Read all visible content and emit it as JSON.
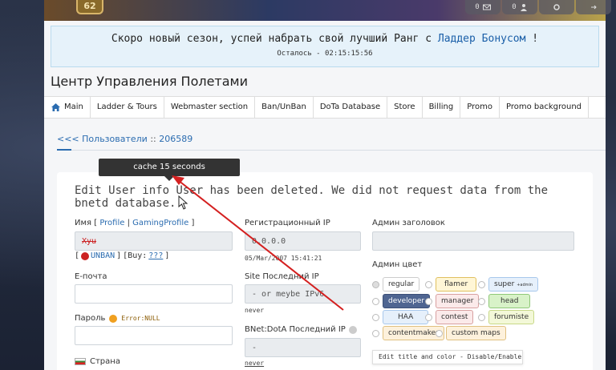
{
  "top": {
    "level": "62",
    "icons": [
      {
        "name": "mail-icon",
        "count": "0"
      },
      {
        "name": "friends-icon",
        "count": "0"
      },
      {
        "name": "settings-icon",
        "count": ""
      },
      {
        "name": "logout-icon",
        "count": ""
      }
    ]
  },
  "notice": {
    "text_before": "Скоро новый сезон, успей набрать свой лучший Ранг с",
    "link": "Ладдер Бонусом",
    "text_after": "!",
    "remaining_label": "Осталось -",
    "remaining_time": "02:15:15:56"
  },
  "title": "Центр Управления Полетами",
  "nav": [
    "Main",
    "Ladder & Tours",
    "Webmaster section",
    "Ban/UnBan",
    "DoTa Database",
    "Store",
    "Billing",
    "Promo",
    "Promo background"
  ],
  "breadcrumb": {
    "back": "<<<",
    "section": "Пользователи",
    "sep": "::",
    "id": "206589"
  },
  "tooltip": "cache 15 seconds",
  "edit_title": "Edit User info User has been deleted. We did not request data from the bnetd database.",
  "form": {
    "name_label": "Имя",
    "profile_link": "Profile",
    "gaming_profile_link": "GamingProfile",
    "name_value": "Xуu",
    "unban": "UNBAN",
    "buy_label": "[Buy:",
    "buy_value": "???",
    "email_label": "E-почта",
    "password_label": "Пароль",
    "password_error": "Error:NULL",
    "country_label": "Страна",
    "reg_ip_label": "Регистрационный IP",
    "reg_ip_value": "0.0.0.0",
    "reg_ip_date": "05/Mar/2007 15:41:21",
    "site_ip_label": "Site Последний IP",
    "site_ip_value": "- or meybe IPv6",
    "site_ip_hint": "never",
    "bnet_ip_label": "BNet:DotA Последний IP",
    "bnet_ip_value": "-",
    "bnet_ip_hint": "never",
    "admin_header_label": "Админ заголовок",
    "admin_color_label": "Админ цвет",
    "edit_title_color": "Edit title and color - Disable/Enable"
  },
  "colors": [
    {
      "label": "regular",
      "bg": "#ffffff",
      "fg": "#333333",
      "border": "#cccccc"
    },
    {
      "label": "flamer",
      "bg": "#fff6d6",
      "fg": "#333333",
      "border": "#e0c060"
    },
    {
      "label": "super",
      "suffix": "+admin",
      "bg": "#e6f0fb",
      "fg": "#333333",
      "border": "#a8c8ec"
    },
    {
      "label": "developer",
      "bg": "#4f6591",
      "fg": "#ffffff",
      "border": "#3c5078"
    },
    {
      "label": "manager",
      "bg": "#fbeaea",
      "fg": "#333333",
      "border": "#d8a0a0"
    },
    {
      "label": "head",
      "bg": "#d8f2c8",
      "fg": "#333333",
      "border": "#8fc878"
    },
    {
      "label": "HAA",
      "bg": "#e6f0fb",
      "fg": "#333333",
      "border": "#a8c8ec"
    },
    {
      "label": "contest",
      "bg": "#fbeaea",
      "fg": "#333333",
      "border": "#d8a0a0"
    },
    {
      "label": "forumiste",
      "bg": "#f3f8d8",
      "fg": "#333333",
      "border": "#c8d888"
    },
    {
      "label": "contentmaker",
      "bg": "#fdf1dc",
      "fg": "#333333",
      "border": "#e0c080"
    },
    {
      "label": "custom maps",
      "bg": "#fdf1dc",
      "fg": "#333333",
      "border": "#e0c080"
    }
  ],
  "accent": "#2b6cb0",
  "annotation_color": "#d42020"
}
